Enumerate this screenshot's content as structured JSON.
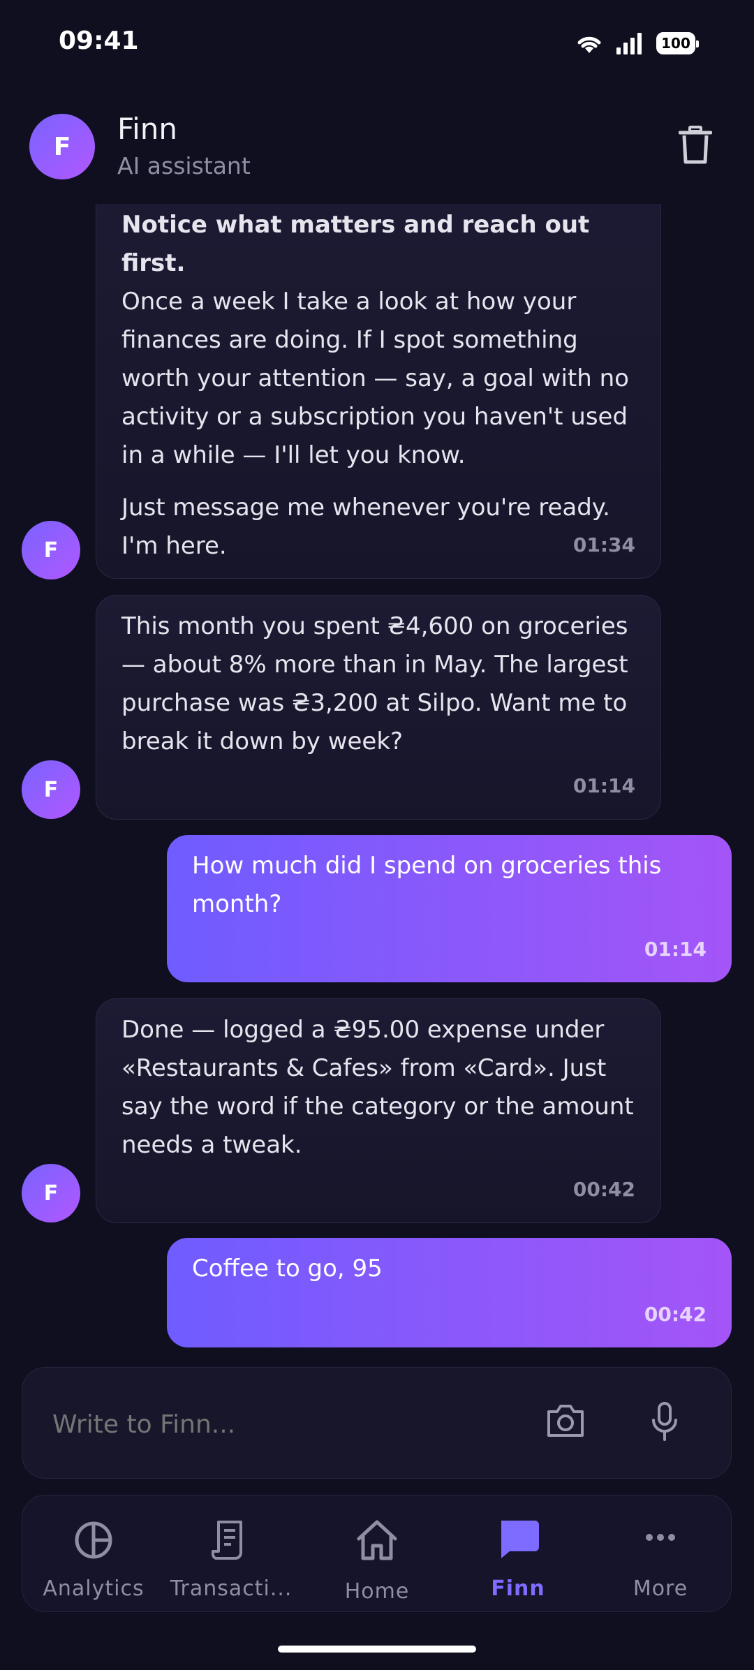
{
  "status_bar": {
    "time": "09:41",
    "battery": "100"
  },
  "header": {
    "avatar_letter": "F",
    "name": "Finn",
    "subtitle": "AI assistant"
  },
  "messages": [
    {
      "from": "ai",
      "heading": "Notice what matters and reach out first.",
      "text": "Once a week I take a look at how your finances are doing. If I spot something worth your attention — say, a goal with no activity or a subscription you haven't used in a while — I'll let you know.",
      "text2": "Just message me whenever you're ready. I'm here.",
      "time": "01:34"
    },
    {
      "from": "ai",
      "text": "This month you spent ₴4,600 on groceries — about 8% more than in May. The largest purchase was ₴3,200 at Silpo. Want me to break it down by week?",
      "time": "01:14"
    },
    {
      "from": "user",
      "text": "How much did I spend on groceries this month?",
      "time": "01:14"
    },
    {
      "from": "ai",
      "text": "Done — logged a ₴95.00 expense under «Restaurants & Cafes» from «Card». Just say the word if the category or the amount needs a tweak.",
      "time": "00:42"
    },
    {
      "from": "user",
      "text": "Coffee to go, 95",
      "time": "00:42"
    }
  ],
  "ai_avatar_letter": "F",
  "input": {
    "placeholder": "Write to Finn..."
  },
  "nav": [
    {
      "label": "Analytics",
      "icon": "pie-chart-icon"
    },
    {
      "label": "Transacti...",
      "icon": "receipt-icon"
    },
    {
      "label": "Home",
      "icon": "home-icon"
    },
    {
      "label": "Finn",
      "icon": "chat-icon",
      "active": true
    },
    {
      "label": "More",
      "icon": "more-icon"
    }
  ],
  "colors": {
    "background": "#0f0f1f",
    "accent": "#7e6bff",
    "user_bubble_start": "#6f5cff",
    "user_bubble_end": "#a455f7",
    "ai_bubble": "#1b1930",
    "muted_text": "#8f8ea3"
  }
}
